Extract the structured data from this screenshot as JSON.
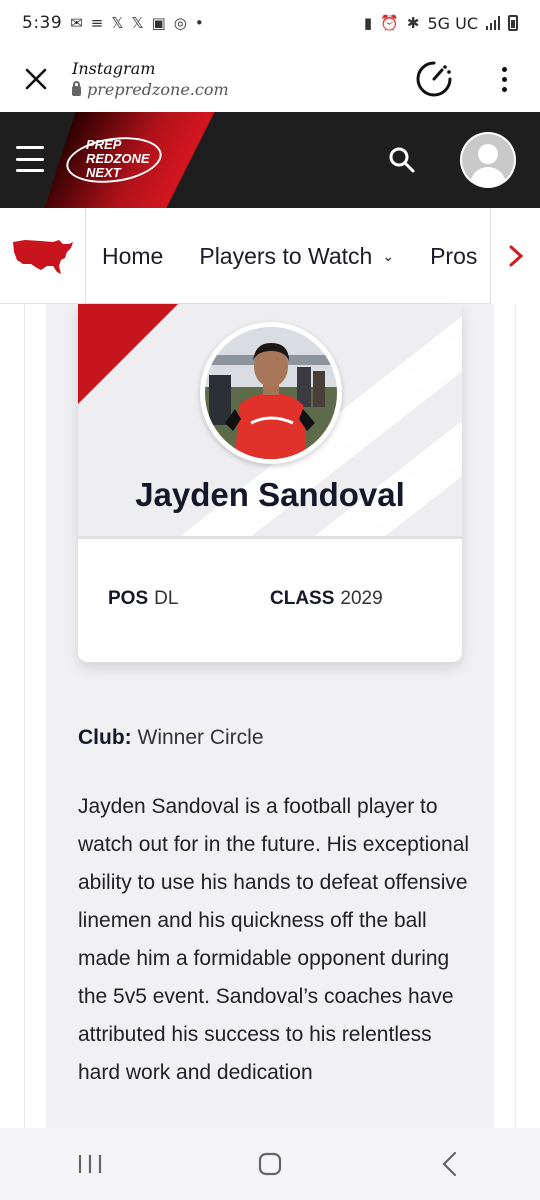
{
  "status_bar": {
    "time": "5:39",
    "network": "5G UC",
    "notification_icons": [
      "mail-icon",
      "stack-icon",
      "x-icon",
      "x-icon",
      "voicemail-icon",
      "instagram-icon",
      "dot-icon"
    ],
    "system_icons": [
      "battery-saver-icon",
      "alarm-icon",
      "bluetooth-icon",
      "signal-icon",
      "battery-icon"
    ]
  },
  "browser": {
    "app_title": "Instagram",
    "url": "prepredzone.com"
  },
  "header": {
    "logo_lines": [
      "PREP",
      "REDZONE",
      "NEXT"
    ],
    "colors": {
      "background": "#1e1e1e",
      "accent_red": "#d4161f"
    }
  },
  "nav": {
    "items": [
      {
        "label": "Home"
      },
      {
        "label": "Players to Watch",
        "has_dropdown": true
      },
      {
        "label": "Pros"
      }
    ]
  },
  "player": {
    "name": "Jayden Sandoval",
    "pos_label": "POS",
    "pos_value": "DL",
    "class_label": "CLASS",
    "class_value": "2029",
    "club_label": "Club:",
    "club_value": "Winner Circle",
    "bio": "Jayden Sandoval is a football player to watch out for in the future. His exceptional ability to use his hands to defeat offensive linemen and his quickness off the ball made him a formidable opponent during the 5v5 event. Sandoval’s coaches have attributed his success to his relentless hard work and dedication"
  }
}
